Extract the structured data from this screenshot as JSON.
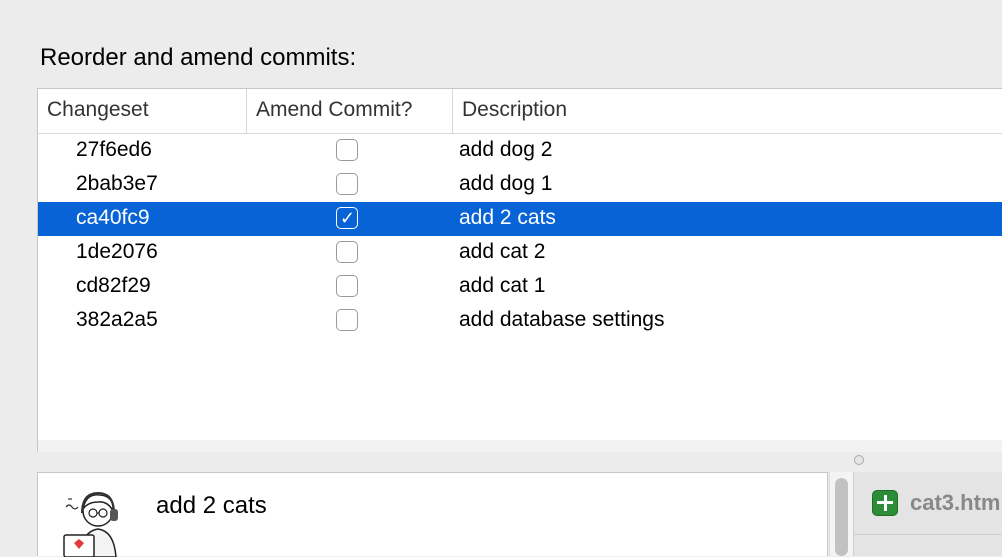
{
  "dialog": {
    "title": "Reorder and amend commits:"
  },
  "table": {
    "columns": {
      "changeset": "Changeset",
      "amend": "Amend Commit?",
      "description": "Description"
    },
    "rows": [
      {
        "changeset": "27f6ed6",
        "amend": false,
        "description": "add dog 2",
        "selected": false
      },
      {
        "changeset": "2bab3e7",
        "amend": false,
        "description": "add dog 1",
        "selected": false
      },
      {
        "changeset": "ca40fc9",
        "amend": true,
        "description": "add 2 cats",
        "selected": true
      },
      {
        "changeset": "1de2076",
        "amend": false,
        "description": "add cat 2",
        "selected": false
      },
      {
        "changeset": "cd82f29",
        "amend": false,
        "description": "add cat 1",
        "selected": false
      },
      {
        "changeset": "382a2a5",
        "amend": false,
        "description": "add database settings",
        "selected": false
      }
    ]
  },
  "detail": {
    "message": "add 2 cats",
    "avatar_icon": "developer-avatar-icon"
  },
  "files": [
    {
      "name": "cat3.htm",
      "status_icon": "add-icon"
    }
  ],
  "colors": {
    "selection": "#0863d6",
    "add": "#2d8c38"
  }
}
